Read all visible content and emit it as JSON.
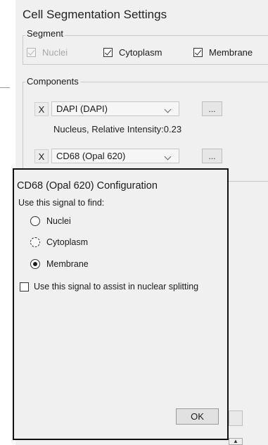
{
  "window": {
    "title": "Cell Segmentation Settings"
  },
  "segment": {
    "caption": "Segment",
    "options": [
      {
        "label": "Nuclei",
        "checked": true,
        "disabled": true
      },
      {
        "label": "Cytoplasm",
        "checked": true,
        "disabled": false
      },
      {
        "label": "Membrane",
        "checked": true,
        "disabled": false
      }
    ]
  },
  "components": {
    "caption": "Components",
    "rows": [
      {
        "remove_label": "X",
        "selected": "DAPI (DAPI)",
        "more_label": "...",
        "info": "Nucleus, Relative Intensity:0.23"
      },
      {
        "remove_label": "X",
        "selected": "CD68 (Opal 620)",
        "more_label": "..."
      }
    ]
  },
  "dialog": {
    "title": "CD68 (Opal 620) Configuration",
    "subtitle": "Use this signal to find:",
    "options": [
      {
        "label": "Nuclei",
        "selected": false
      },
      {
        "label": "Cytoplasm",
        "selected": false,
        "focused": true
      },
      {
        "label": "Membrane",
        "selected": true
      }
    ],
    "assist_label": "Use this signal to assist in nuclear splitting",
    "assist_checked": false,
    "ok_label": "OK"
  },
  "colors": {
    "background": "#f0f0f0",
    "border": "#111111"
  }
}
